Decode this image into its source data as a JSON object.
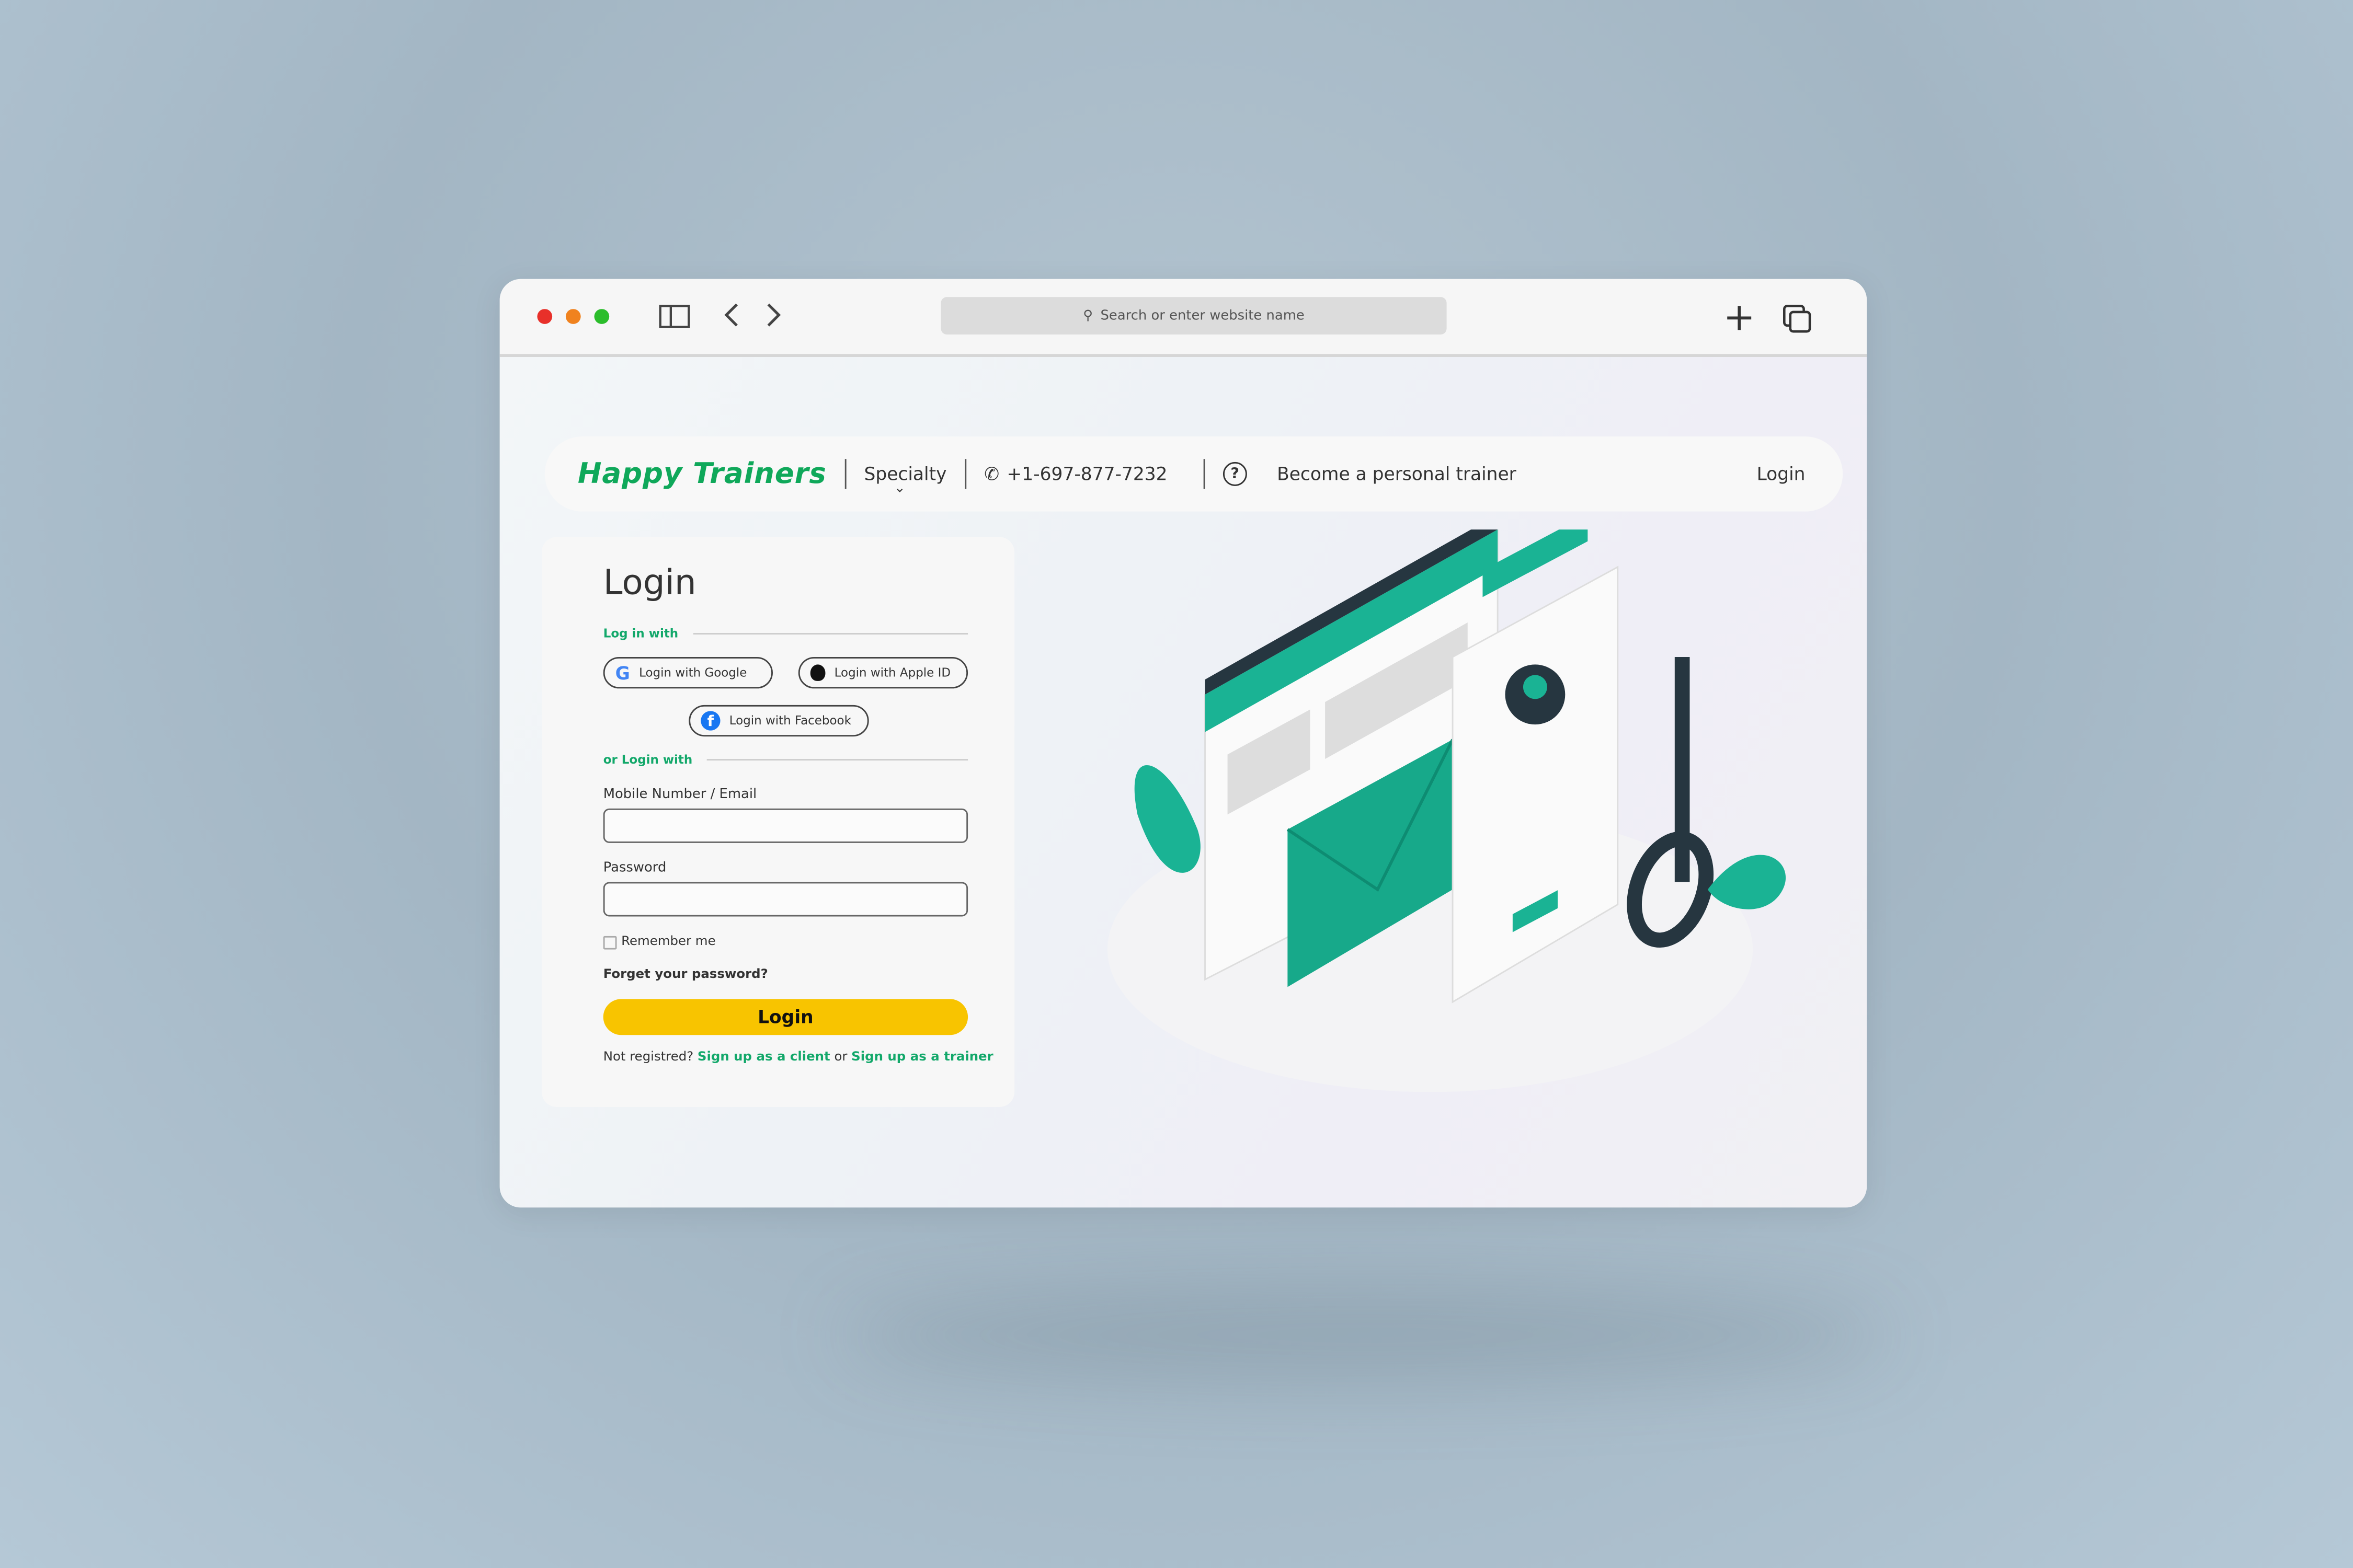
{
  "browser": {
    "url_placeholder": "Search or enter website name",
    "colors": {
      "close": "#e8302a",
      "minimize": "#f0821e",
      "maximize": "#2bbd2b"
    }
  },
  "nav": {
    "logo": "Happy Trainers",
    "specialty": "Specialty",
    "phone": "+1-697-877-7232",
    "become_trainer": "Become a personal trainer",
    "login": "Login"
  },
  "login": {
    "title": "Login",
    "log_in_with": "Log in with",
    "google": "Login with Google",
    "apple": "Login with Apple ID",
    "facebook": "Login with Facebook",
    "or_login_with": "or Login with",
    "mobile_label": "Mobile Number / Email",
    "mobile_value": "",
    "password_label": "Password",
    "password_value": "",
    "remember": "Remember me",
    "remember_checked": false,
    "forgot": "Forget your password?",
    "submit": "Login",
    "not_registered": "Not registred?",
    "signup_client": "Sign up as a client",
    "or": "or",
    "signup_trainer": "Sign up as a trainer"
  },
  "colors": {
    "brand": "#0fa85a",
    "accent": "#12a86a",
    "button": "#f8c400",
    "illustration": "#1ab394"
  }
}
